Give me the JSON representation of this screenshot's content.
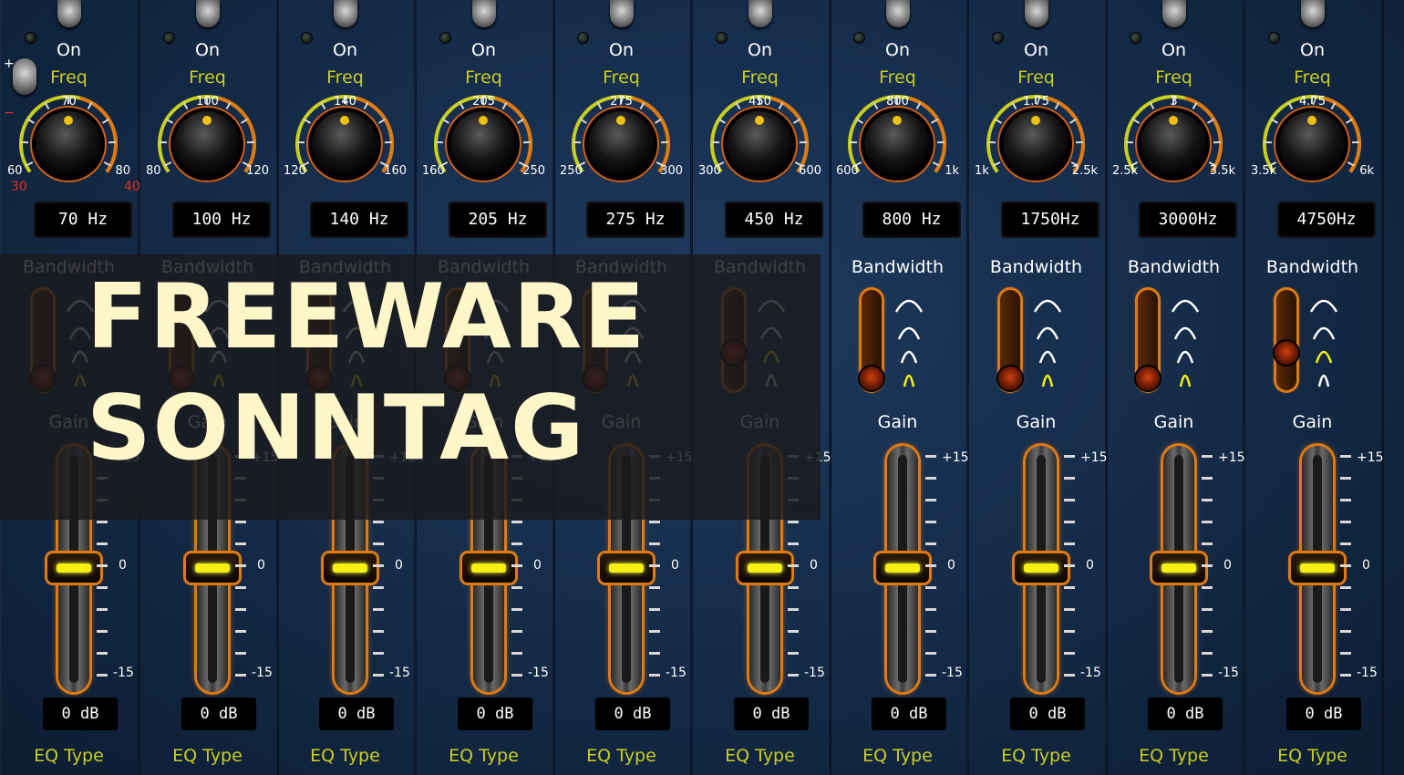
{
  "labels": {
    "on": "On",
    "freq": "Freq",
    "bandwidth": "Bandwidth",
    "gain": "Gain",
    "eq_type": "EQ Type",
    "plus": "+",
    "minus": "−",
    "gain_max": "+15",
    "gain_mid": "0",
    "gain_min": "-15"
  },
  "band1_extra": {
    "range_min": "30",
    "range_max": "40"
  },
  "overlay": {
    "line1": "FREEWARE",
    "line2": "SONNTAG"
  },
  "colors": {
    "accent": "#e07a10",
    "freq_label": "#c9cf1e",
    "overlay_text": "#fdf6c8",
    "handle_bar": "#f5f010"
  },
  "bands": [
    {
      "scale_min": "60",
      "scale_center": "70",
      "scale_max": "80",
      "freq_value": "70  Hz",
      "gain_value": "0 dB",
      "bandwidth_position": 4,
      "dimmed": true
    },
    {
      "scale_min": "80",
      "scale_center": "100",
      "scale_max": "120",
      "freq_value": "100 Hz",
      "gain_value": "0 dB",
      "bandwidth_position": 4,
      "dimmed": true
    },
    {
      "scale_min": "120",
      "scale_center": "140",
      "scale_max": "160",
      "freq_value": "140 Hz",
      "gain_value": "0 dB",
      "bandwidth_position": 4,
      "dimmed": true
    },
    {
      "scale_min": "160",
      "scale_center": "205",
      "scale_max": "250",
      "freq_value": "205 Hz",
      "gain_value": "0 dB",
      "bandwidth_position": 4,
      "dimmed": true
    },
    {
      "scale_min": "250",
      "scale_center": "275",
      "scale_max": "300",
      "freq_value": "275 Hz",
      "gain_value": "0 dB",
      "bandwidth_position": 4,
      "dimmed": true
    },
    {
      "scale_min": "300",
      "scale_center": "450",
      "scale_max": "600",
      "freq_value": "450 Hz",
      "gain_value": "0 dB",
      "bandwidth_position": 3,
      "dimmed": true
    },
    {
      "scale_min": "600",
      "scale_center": "800",
      "scale_max": "1k",
      "freq_value": "800 Hz",
      "gain_value": "0 dB",
      "bandwidth_position": 4,
      "dimmed": false
    },
    {
      "scale_min": "1k",
      "scale_center": "1.75",
      "scale_max": "2.5k",
      "freq_value": "1750Hz",
      "gain_value": "0 dB",
      "bandwidth_position": 4,
      "dimmed": false
    },
    {
      "scale_min": "2.5k",
      "scale_center": "3",
      "scale_max": "3.5k",
      "freq_value": "3000Hz",
      "gain_value": "0 dB",
      "bandwidth_position": 4,
      "dimmed": false
    },
    {
      "scale_min": "3.5k",
      "scale_center": "4.75",
      "scale_max": "6k",
      "freq_value": "4750Hz",
      "gain_value": "0 dB",
      "bandwidth_position": 3,
      "dimmed": false
    }
  ]
}
